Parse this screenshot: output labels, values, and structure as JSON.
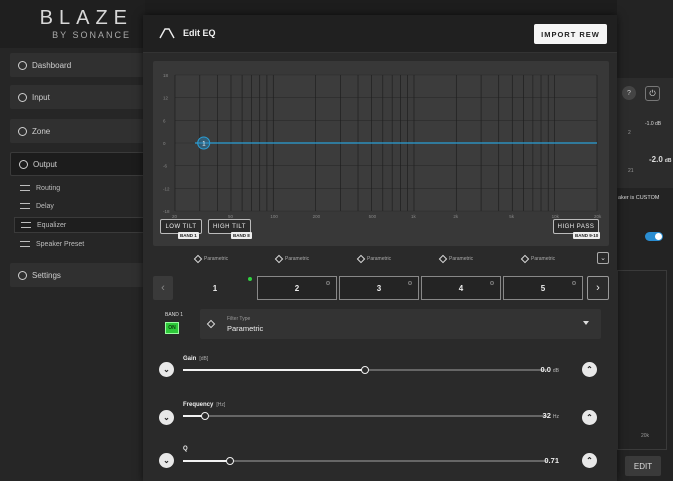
{
  "brand": {
    "name": "BLAZE",
    "sub": "BY SONANCE"
  },
  "sidebar": {
    "items": [
      {
        "label": "Dashboard"
      },
      {
        "label": "Input"
      },
      {
        "label": "Zone"
      },
      {
        "label": "Output"
      },
      {
        "label": "Settings"
      }
    ],
    "output_sub": [
      {
        "label": "Routing"
      },
      {
        "label": "Delay"
      },
      {
        "label": "Equalizer"
      },
      {
        "label": "Speaker Preset"
      }
    ]
  },
  "background": {
    "help": "?",
    "val_small": "-1.0 dB",
    "val_main": "-2.0",
    "val_main_unit": "dB",
    "preset_note": "aker is CUSTOM",
    "edit": "EDIT",
    "small_a": "2",
    "small_b": "21",
    "bottom_hz": "20k"
  },
  "modal": {
    "title": "Edit EQ",
    "import_label": "IMPORT REW"
  },
  "graph": {
    "y_labels": [
      "18",
      "12",
      "6",
      "0",
      "-6",
      "-12",
      "-18"
    ],
    "x_labels": [
      "20",
      "50",
      "100",
      "200",
      "500",
      "1k",
      "2k",
      "5k",
      "10k",
      "20k"
    ],
    "marker": "1",
    "low_tilt": "LOW TILT",
    "high_tilt": "HIGH TILT",
    "high_pass": "HIGH PASS",
    "band_tags": {
      "low": "BAND 1",
      "high": "BAND 8",
      "hp": "BAND 9-10"
    }
  },
  "filters": [
    "Parametric",
    "Parametric",
    "Parametric",
    "Parametric",
    "Parametric"
  ],
  "tabs": {
    "prev": "‹",
    "next": "›",
    "items": [
      {
        "label": "1"
      },
      {
        "label": "2"
      },
      {
        "label": "3"
      },
      {
        "label": "4"
      },
      {
        "label": "5"
      }
    ]
  },
  "band": {
    "label": "BAND 1",
    "state": "ON",
    "filter_type_label": "Filter Type",
    "filter_type": "Parametric"
  },
  "params": [
    {
      "name": "Gain",
      "unit": "[dB]",
      "value": "0.0",
      "value_unit": "dB",
      "level": 0.5
    },
    {
      "name": "Frequency",
      "unit": "[Hz]",
      "value": "32",
      "value_unit": "Hz",
      "level": 0.06
    },
    {
      "name": "Q",
      "unit": "",
      "value": "0.71",
      "value_unit": "",
      "level": 0.13
    }
  ],
  "colors": {
    "accent": "#2a9fd6",
    "on": "#2ec93a"
  }
}
